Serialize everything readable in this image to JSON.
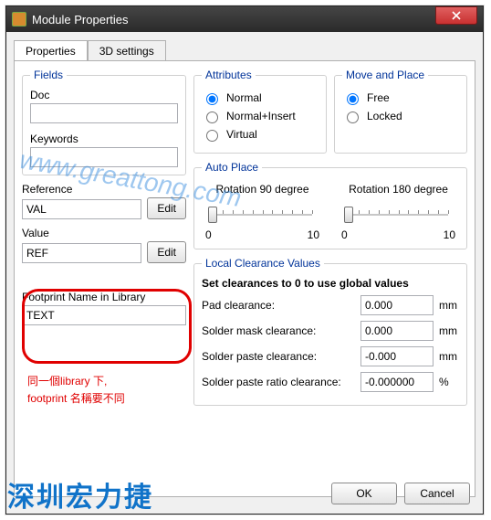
{
  "window": {
    "title": "Module Properties"
  },
  "tabs": {
    "properties": "Properties",
    "settings3d": "3D settings"
  },
  "fields": {
    "legend": "Fields",
    "doc_label": "Doc",
    "doc_value": "",
    "keywords_label": "Keywords",
    "keywords_value": "",
    "reference_label": "Reference",
    "reference_value": "VAL",
    "value_label": "Value",
    "value_value": "REF",
    "edit_label": "Edit",
    "footprint_label": "Footprint Name in Library",
    "footprint_value": "TEXT"
  },
  "attributes": {
    "legend": "Attributes",
    "normal": "Normal",
    "normal_insert": "Normal+Insert",
    "virtual": "Virtual"
  },
  "move_place": {
    "legend": "Move and Place",
    "free": "Free",
    "locked": "Locked"
  },
  "autoplace": {
    "legend": "Auto Place",
    "rot90": "Rotation 90 degree",
    "rot180": "Rotation 180 degree",
    "min": "0",
    "max": "10"
  },
  "clearance": {
    "legend": "Local Clearance Values",
    "hint": "Set clearances to 0 to use global values",
    "pad_label": "Pad clearance:",
    "pad_value": "0.000",
    "mask_label": "Solder mask clearance:",
    "mask_value": "0.000",
    "paste_label": "Solder paste clearance:",
    "paste_value": "-0.000",
    "ratio_label": "Solder paste ratio clearance:",
    "ratio_value": "-0.000000",
    "mm": "mm",
    "pct": "%"
  },
  "dialog": {
    "ok": "OK",
    "cancel": "Cancel"
  },
  "annotation": {
    "line1": "同一個library 下,",
    "line2": "footprint 名稱要不同"
  },
  "watermark": {
    "blue": "深圳宏力捷",
    "url": "www.greattong.com"
  }
}
